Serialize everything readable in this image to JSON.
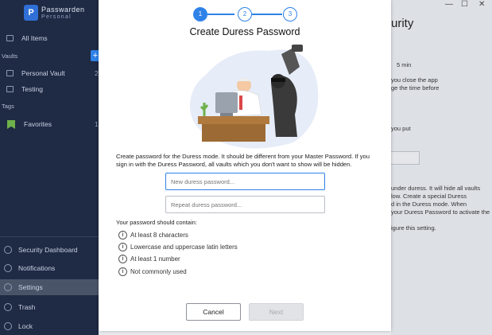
{
  "app": {
    "brand": "Passwarden",
    "brand_sub": "Personal",
    "logo_letter": "P"
  },
  "sidebar": {
    "all_items": "All Items",
    "vaults_heading": "Vaults",
    "add_label": "+",
    "vaults": [
      {
        "label": "Personal Vault",
        "count": "2"
      },
      {
        "label": "Testing",
        "count": ""
      }
    ],
    "tags_heading": "Tags",
    "tags": [
      {
        "label": "Favorites",
        "count": "1"
      }
    ],
    "bottom": [
      {
        "label": "Security Dashboard"
      },
      {
        "label": "Notifications"
      },
      {
        "label": "Settings"
      },
      {
        "label": "Trash"
      },
      {
        "label": "Lock"
      }
    ]
  },
  "background": {
    "title": "urity",
    "lines": [
      "5 min",
      "you close the app",
      "ge the time before",
      "you put",
      "under duress. It will hide all vaults",
      "low. Create a special Duress",
      "d in the Duress mode. When",
      "your Duress Password to activate the",
      "igure this setting."
    ],
    "window_controls": [
      "—",
      "☐",
      "✕"
    ]
  },
  "dialog": {
    "steps": [
      "1",
      "2",
      "3"
    ],
    "active_step": 1,
    "title": "Create Duress Password",
    "description": "Create password for the Duress mode. It should be different from your Master Password. If you sign in with the Duress Password, all vaults which you don't want to show will be hidden.",
    "new_password_placeholder": "New duress password...",
    "repeat_password_placeholder": "Repeat duress password...",
    "requirements_heading": "Your password should contain:",
    "requirements": [
      "At least 8 characters",
      "Lowercase and uppercase latin letters",
      "At least 1 number",
      "Not commonly used"
    ],
    "cancel_label": "Cancel",
    "next_label": "Next"
  },
  "colors": {
    "sidebar_bg": "#1f2a44",
    "accent": "#2f82e8",
    "active_row": "#4a5468"
  }
}
